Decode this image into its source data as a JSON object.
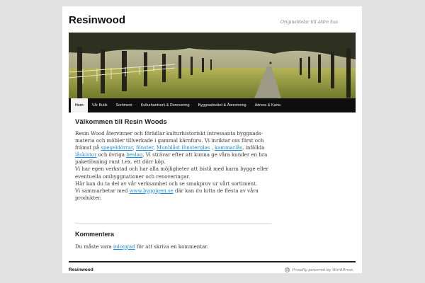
{
  "site": {
    "title": "Resinwood",
    "tagline": "Originaldelar till äldre hus"
  },
  "nav": {
    "items": [
      {
        "label": "Hem"
      },
      {
        "label": "Vår Butik"
      },
      {
        "label": "Sortiment"
      },
      {
        "label": "Kulturhantverk & Renovering"
      },
      {
        "label": "Byggnadsvård & Återvinning"
      },
      {
        "label": "Adress & Karta"
      }
    ]
  },
  "post": {
    "title": "Välkommen till Resin Woods",
    "line1": "Resin Wood återvinner och förädlar kulturhistoriskt intressanta byggnads-",
    "line2": "materia och möbler tillverkade i gammal kärnfuru. Vi inriktar oss först och",
    "line3_prefix": "främst på ",
    "link_spegeldorrar": "spegeldörrar",
    "sep1": ", ",
    "link_fonster": "fönster",
    "sep2": ", ",
    "link_munblast": "Munblåst fönsterglas",
    "sep3": " , ",
    "link_kammarlas": "kammarlås",
    "sep4": ",  infällda",
    "link_laskistor": "låskistor",
    "line4_mid": " och övriga ",
    "link_beslag": "beslag",
    "line4_suffix": ". Vi strävar efter att kunna ge våra kunder en bra",
    "line5": "paketlösning runt t.ex. ett dörr köp.",
    "line6": "Vi har egen verkstad och har alla möjligheter att bistå med karm bygge eller",
    "line7": "eventuella ombyggnationer och renoveringar.",
    "line8": "Här kan du ta del av vår verksamhet och se smakprov ur vårt sortiment.",
    "line9_prefix": "Vi sammarbetar med ",
    "link_byggigen": "www.byggigen.se",
    "line9_suffix": " där kan du hitta de flesta av våra",
    "line10": "produkter."
  },
  "comments": {
    "title": "Kommentera",
    "note_prefix": "Du måste vara ",
    "login_link": "inloggad",
    "note_suffix": " för att skriva en kommentar."
  },
  "footer": {
    "title": "Resinwood",
    "credit": "Proudly powered by WordPress.",
    "wp_icon": "wordpress-icon"
  },
  "colors": {
    "link": "#1b8be0",
    "nav_bg": "#0e0e0e",
    "page_bg": "#e2e2e2"
  }
}
